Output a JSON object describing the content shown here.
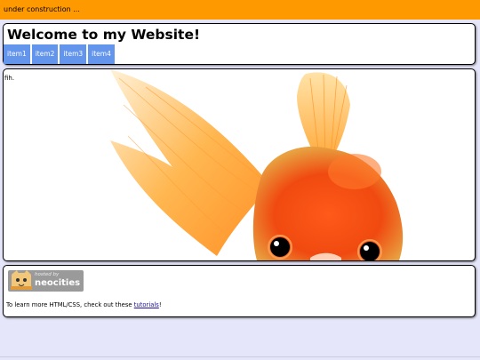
{
  "topbar": {
    "text": "under construction ..."
  },
  "header": {
    "title": "Welcome to my Website!",
    "nav": [
      "item1",
      "item2",
      "item3",
      "item4"
    ]
  },
  "main": {
    "text": "fih."
  },
  "footer": {
    "badge_small": "hosted by",
    "badge_big": "neocities",
    "text_before": "To learn more HTML/CSS, check out these ",
    "link_text": "tutorials",
    "text_after": "!"
  },
  "colors": {
    "topbar": "#ff9900",
    "page_bg": "#e6e6fa",
    "nav_bg": "#6495ed"
  }
}
